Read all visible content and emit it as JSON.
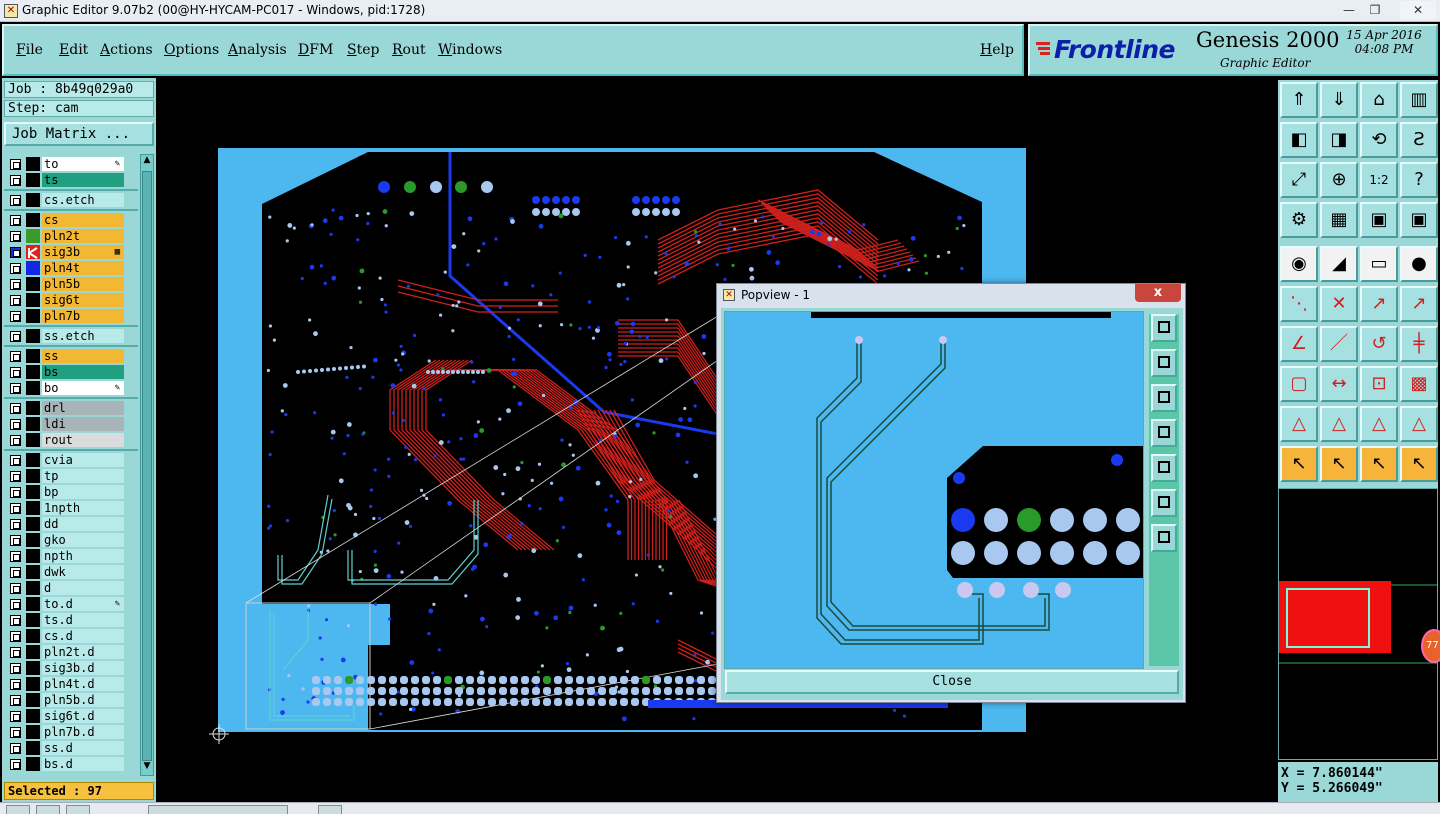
{
  "window": {
    "title": "Graphic Editor 9.07b2 (00@HY-HYCAM-PC017 - Windows, pid:1728)",
    "controls": [
      "—",
      "❐",
      "✕"
    ]
  },
  "menu": {
    "items": [
      "File",
      "Edit",
      "Actions",
      "Options",
      "Analysis",
      "DFM",
      "Step",
      "Rout",
      "Windows"
    ],
    "help": "Help"
  },
  "brand": {
    "logo": "Frontline",
    "product": "Genesis 2000",
    "subtitle": "Graphic Editor",
    "date": "15 Apr 2016",
    "time": "04:08 PM"
  },
  "job": {
    "job_label": "Job : 8b49q029a0",
    "step_label": "Step: cam",
    "matrix_button": "Job Matrix ..."
  },
  "layers": [
    {
      "name": "to",
      "color": "#ffffff",
      "flag": "✎",
      "swatch": "#000000"
    },
    {
      "name": "ts",
      "color": "#20a080",
      "swatch": "#000000"
    },
    {
      "sep": true
    },
    {
      "name": "cs.etch",
      "color": "#b8eaea",
      "swatch": "#000000"
    },
    {
      "sep": true
    },
    {
      "name": "cs",
      "color": "#f3b833",
      "swatch": "#000000"
    },
    {
      "name": "pln2t",
      "color": "#f3b833",
      "swatch": "#3b9a2a"
    },
    {
      "name": "sig3b",
      "color": "#f3b833",
      "swatch": "#e02020",
      "flag": "▦",
      "checked": true
    },
    {
      "name": "pln4t",
      "color": "#f3b833",
      "swatch": "#1028e0"
    },
    {
      "name": "pln5b",
      "color": "#f3b833",
      "swatch": "#000000"
    },
    {
      "name": "sig6t",
      "color": "#f3b833",
      "swatch": "#000000"
    },
    {
      "name": "pln7b",
      "color": "#f3b833",
      "swatch": "#000000"
    },
    {
      "sep": true
    },
    {
      "name": "ss.etch",
      "color": "#b8eaea",
      "swatch": "#000000"
    },
    {
      "sep": true
    },
    {
      "name": "ss",
      "color": "#f3b833",
      "swatch": "#000000"
    },
    {
      "name": "bs",
      "color": "#20a080",
      "swatch": "#000000"
    },
    {
      "name": "bo",
      "color": "#ffffff",
      "flag": "✎",
      "swatch": "#000000"
    },
    {
      "sep": true
    },
    {
      "name": "drl",
      "color": "#a8b4b8",
      "swatch": "#000000"
    },
    {
      "name": "ldi",
      "color": "#a8b4b8",
      "swatch": "#000000"
    },
    {
      "name": "rout",
      "color": "#d8dcdc",
      "swatch": "#000000"
    },
    {
      "sep": true
    },
    {
      "name": "cvia",
      "color": "#b8eaea",
      "swatch": "#000000"
    },
    {
      "name": "tp",
      "color": "#b8eaea",
      "swatch": "#000000"
    },
    {
      "name": "bp",
      "color": "#b8eaea",
      "swatch": "#000000"
    },
    {
      "name": "1npth",
      "color": "#b8eaea",
      "swatch": "#000000"
    },
    {
      "name": "dd",
      "color": "#b8eaea",
      "swatch": "#000000"
    },
    {
      "name": "gko",
      "color": "#b8eaea",
      "swatch": "#000000"
    },
    {
      "name": "npth",
      "color": "#b8eaea",
      "swatch": "#000000"
    },
    {
      "name": "dwk",
      "color": "#b8eaea",
      "swatch": "#000000"
    },
    {
      "name": "d",
      "color": "#b8eaea",
      "swatch": "#000000"
    },
    {
      "name": "to.d",
      "color": "#b8eaea",
      "flag": "✎",
      "swatch": "#000000"
    },
    {
      "name": "ts.d",
      "color": "#b8eaea",
      "swatch": "#000000"
    },
    {
      "name": "cs.d",
      "color": "#b8eaea",
      "swatch": "#000000"
    },
    {
      "name": "pln2t.d",
      "color": "#b8eaea",
      "swatch": "#000000"
    },
    {
      "name": "sig3b.d",
      "color": "#b8eaea",
      "swatch": "#000000"
    },
    {
      "name": "pln4t.d",
      "color": "#b8eaea",
      "swatch": "#000000"
    },
    {
      "name": "pln5b.d",
      "color": "#b8eaea",
      "swatch": "#000000"
    },
    {
      "name": "sig6t.d",
      "color": "#b8eaea",
      "swatch": "#000000"
    },
    {
      "name": "pln7b.d",
      "color": "#b8eaea",
      "swatch": "#000000"
    },
    {
      "name": "ss.d",
      "color": "#b8eaea",
      "swatch": "#000000"
    },
    {
      "name": "bs.d",
      "color": "#b8eaea",
      "swatch": "#000000"
    }
  ],
  "status": {
    "selected": "Selected : 97"
  },
  "popview": {
    "title": "Popview - 1",
    "close_label": "Close",
    "close_x": "x"
  },
  "coords": {
    "x": "X = 7.860144\"",
    "y": "Y = 5.266049\""
  },
  "minimap": {
    "badge": "77"
  },
  "colors": {
    "board": "#4db8f0",
    "trace_red": "#d0201c",
    "trace_blue": "#1030e0",
    "pad_light": "#a8c8f0",
    "pad_green": "#2a9a2a",
    "panel": "#9ad7d7"
  }
}
